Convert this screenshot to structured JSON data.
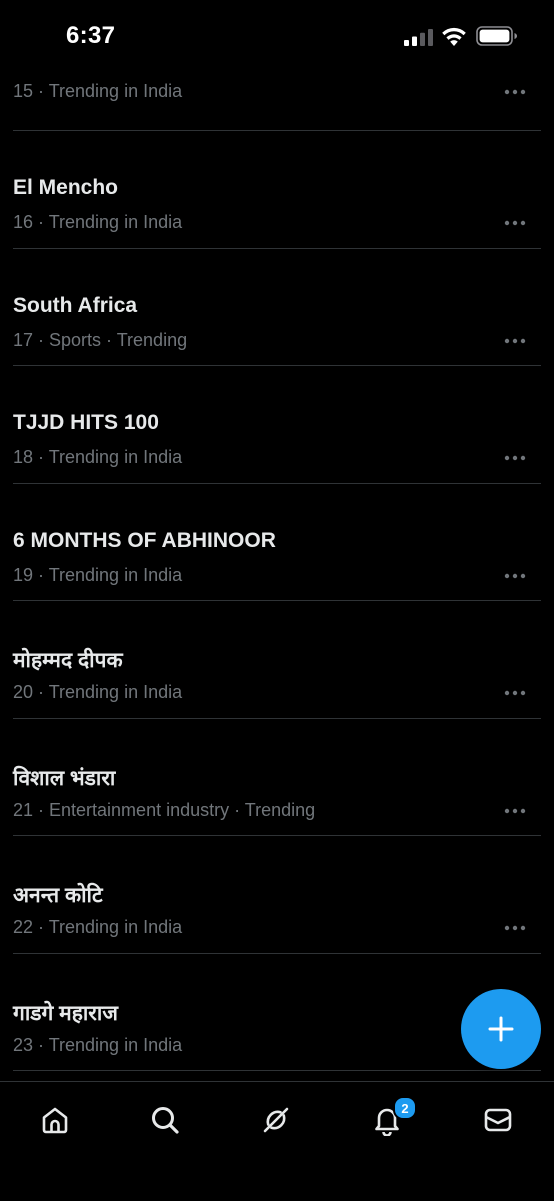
{
  "status_bar": {
    "time": "6:37"
  },
  "trends": [
    {
      "title": "",
      "meta": "15 · Trending in India"
    },
    {
      "title": "El Mencho",
      "meta": "16 · Trending in India"
    },
    {
      "title": "South Africa",
      "meta": "17 · Sports · Trending"
    },
    {
      "title": "TJJD HITS 100",
      "meta": "18 · Trending in India"
    },
    {
      "title": "6 MONTHS OF ABHINOOR",
      "meta": "19 · Trending in India"
    },
    {
      "title": "मोहम्मद दीपक",
      "meta": "20 · Trending in India"
    },
    {
      "title": "विशाल भंडारा",
      "meta": "21 · Entertainment industry · Trending"
    },
    {
      "title": "अनन्त कोटि",
      "meta": "22 · Trending in India"
    },
    {
      "title": "गाडगे महाराज",
      "meta": "23 · Trending in India"
    }
  ],
  "tab_bar": {
    "notifications_badge": "2",
    "tabs": [
      "home-icon",
      "search-icon",
      "grok-icon",
      "bell-icon",
      "mail-icon"
    ]
  },
  "colors": {
    "background": "#000000",
    "accent": "#1d9bf0",
    "primary_text": "#e7e9ea",
    "secondary_text": "#71767b",
    "divider": "#2f3336"
  }
}
